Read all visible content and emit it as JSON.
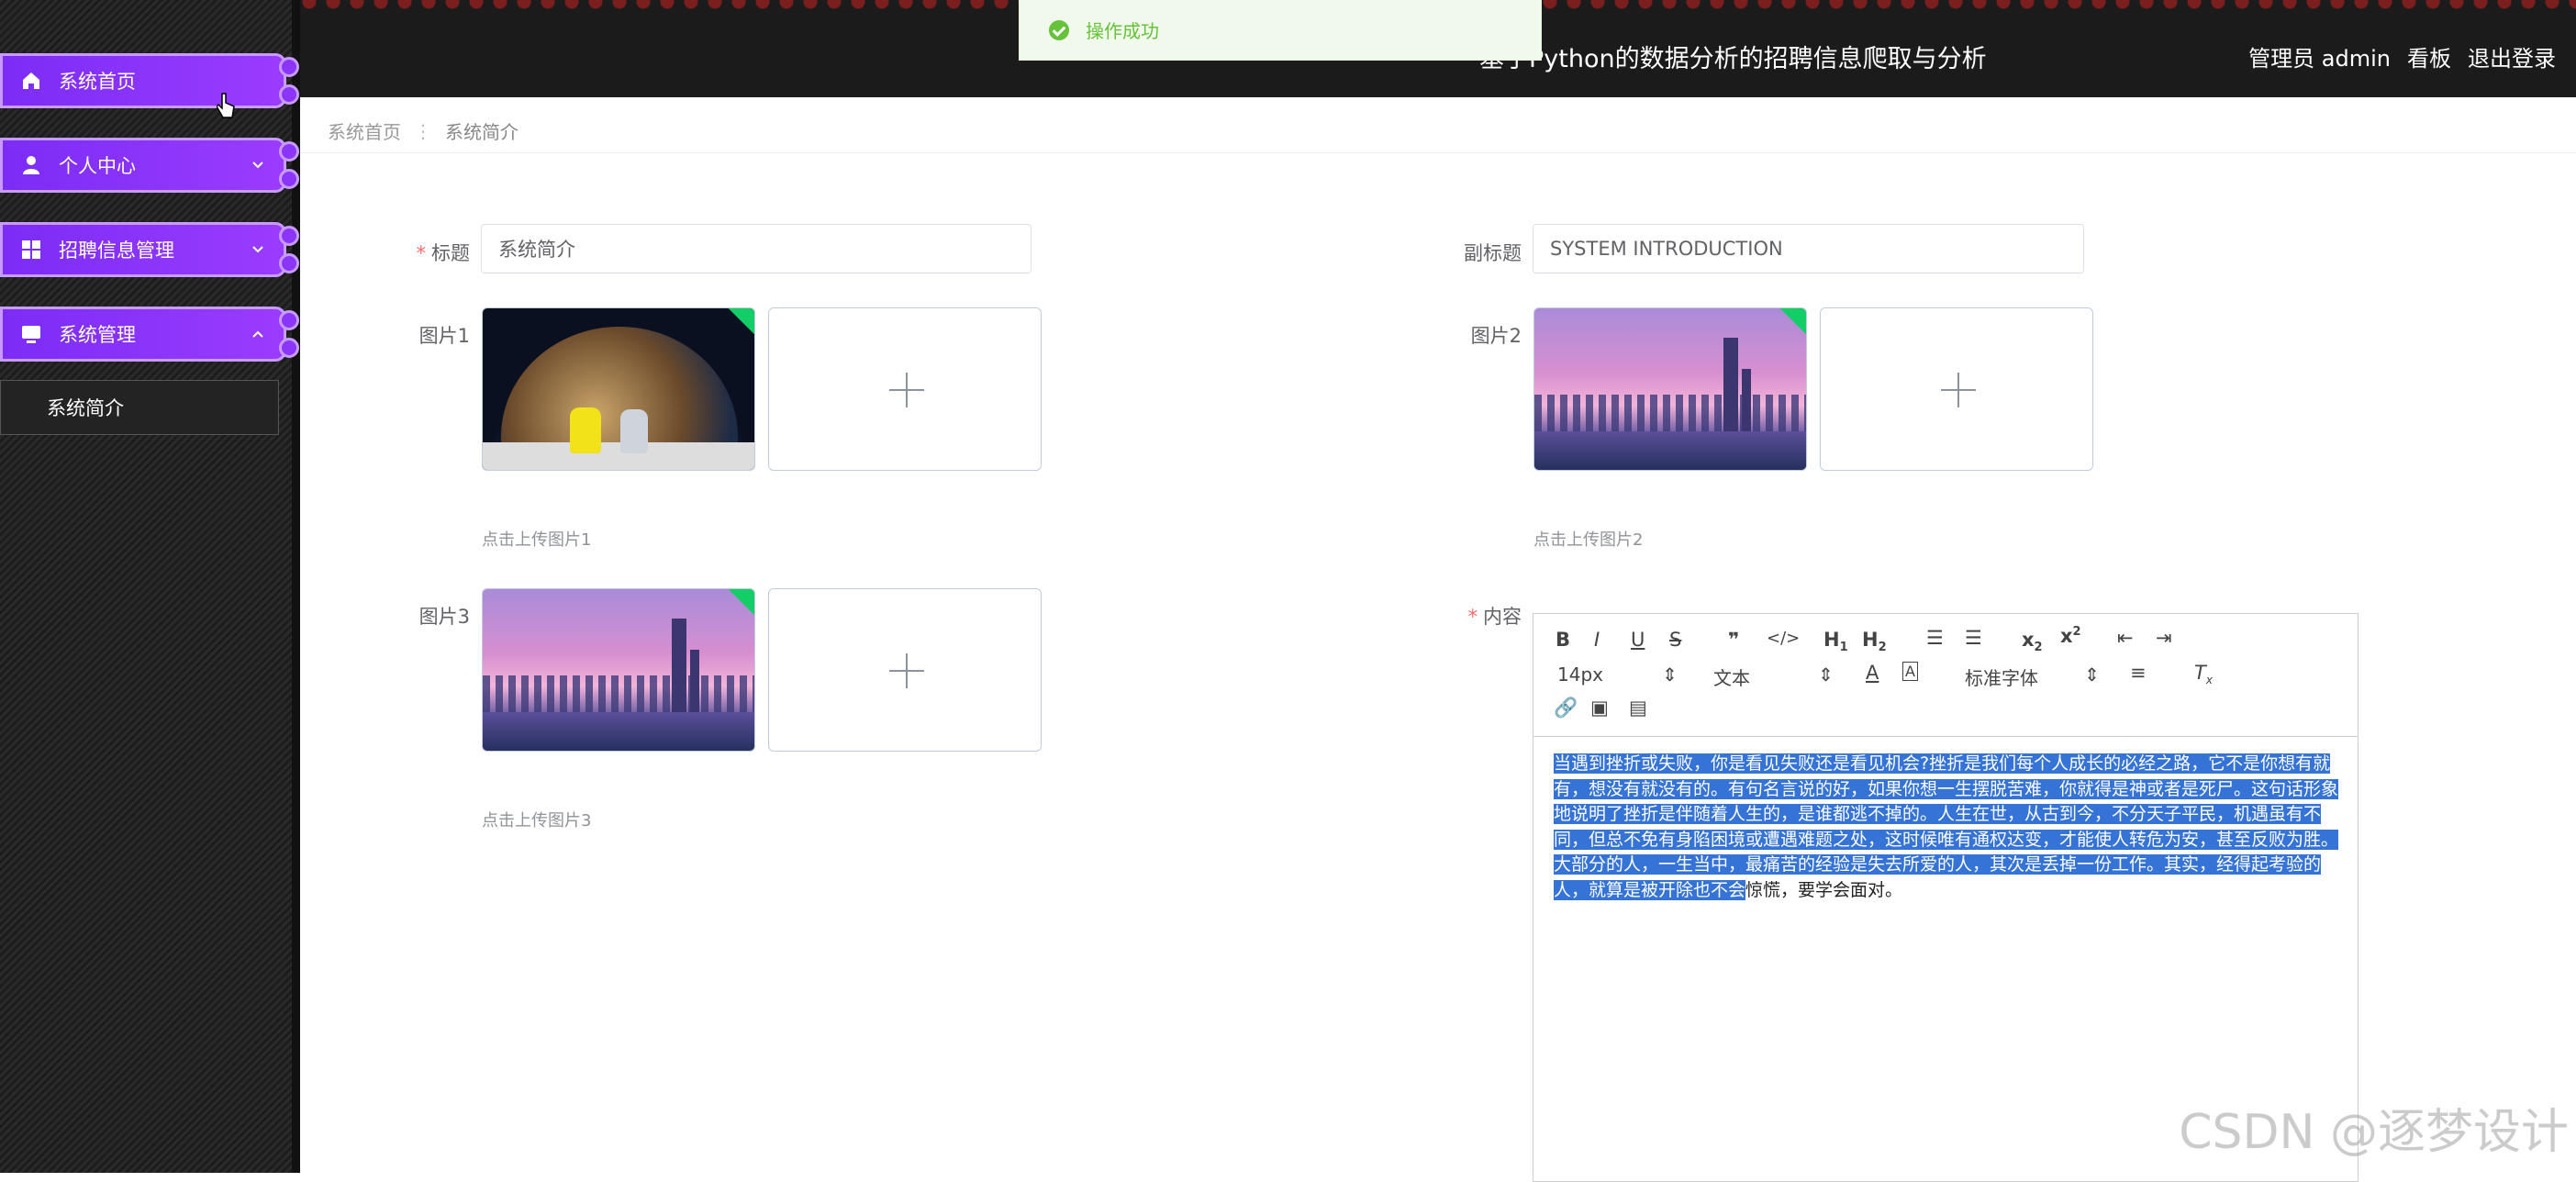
{
  "sidebar": {
    "items": [
      {
        "label": "系统首页",
        "icon": "home-icon"
      },
      {
        "label": "个人中心",
        "icon": "user-icon"
      },
      {
        "label": "招聘信息管理",
        "icon": "grid-icon"
      },
      {
        "label": "系统管理",
        "icon": "monitor-icon"
      }
    ],
    "submenu": {
      "label": "系统简介"
    }
  },
  "header": {
    "title": "基于Python的数据分析的招聘信息爬取与分析",
    "admin": "管理员 admin",
    "dashboard": "看板",
    "logout": "退出登录"
  },
  "toast": {
    "message": "操作成功"
  },
  "breadcrumb": {
    "home": "系统首页",
    "current": "系统简介"
  },
  "form": {
    "title_label": "标题",
    "title_value": "系统简介",
    "subtitle_label": "副标题",
    "subtitle_value": "SYSTEM INTRODUCTION",
    "pic1_label": "图片1",
    "pic1_hint": "点击上传图片1",
    "pic2_label": "图片2",
    "pic2_hint": "点击上传图片2",
    "pic3_label": "图片3",
    "pic3_hint": "点击上传图片3",
    "content_label": "内容"
  },
  "editor": {
    "font_size": "14px",
    "header_select": "文本",
    "font_select": "标准字体",
    "text_highlighted": "当遇到挫折或失败，你是看见失败还是看见机会?挫折是我们每个人成长的必经之路，它不是你想有就有，想没有就没有的。有句名言说的好，如果你想一生摆脱苦难，你就得是神或者是死尸。这句话形象地说明了挫折是伴随着人生的，是谁都逃不掉的。人生在世，从古到今，不分天子平民，机遇虽有不同，但总不免有身陷困境或遭遇难题之处，这时候唯有通权达变，才能使人转危为安，甚至反败为胜。大部分的人，一生当中，最痛苦的经验是失去所爱的人，其次是丢掉一份工作。其实，经得起考验的人，就算是被开除也不会",
    "text_rest": "惊慌，要学会面对。"
  },
  "watermark": "CSDN @逐梦设计"
}
